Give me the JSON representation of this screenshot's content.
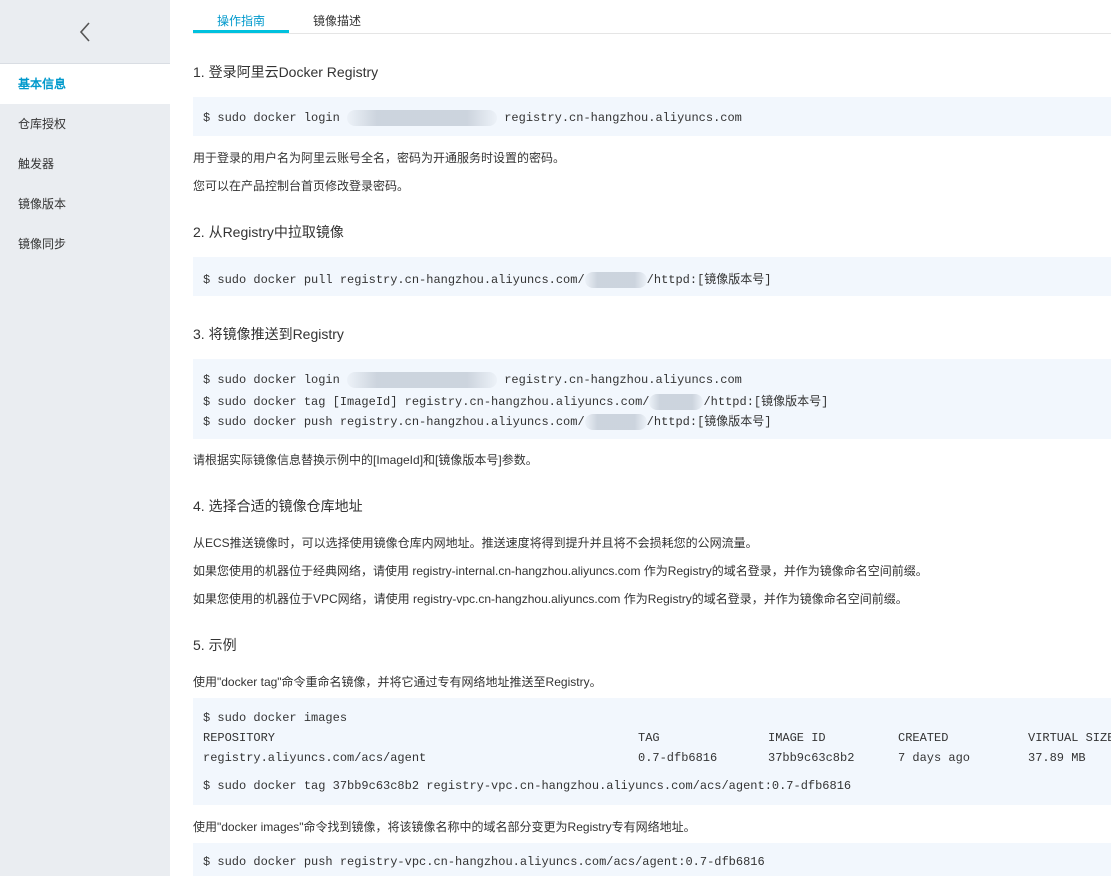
{
  "sidebar": {
    "items": [
      {
        "label": "基本信息",
        "active": true
      },
      {
        "label": "仓库授权"
      },
      {
        "label": "触发器"
      },
      {
        "label": "镜像版本"
      },
      {
        "label": "镜像同步"
      }
    ]
  },
  "tabs": [
    "操作指南",
    "镜像描述"
  ],
  "sections": {
    "s1": {
      "title": "1. 登录阿里云Docker Registry",
      "code": {
        "pre": "$ sudo docker login",
        "post": "registry.cn-hangzhou.aliyuncs.com"
      },
      "notes": [
        "用于登录的用户名为阿里云账号全名，密码为开通服务时设置的密码。",
        "您可以在产品控制台首页修改登录密码。"
      ]
    },
    "s2": {
      "title": "2. 从Registry中拉取镜像",
      "code": {
        "pre": "$ sudo docker pull registry.cn-hangzhou.aliyuncs.com/",
        "post": "/httpd:[镜像版本号]"
      }
    },
    "s3": {
      "title": "3. 将镜像推送到Registry",
      "lines": [
        {
          "pre": "$ sudo docker login",
          "post": "registry.cn-hangzhou.aliyuncs.com"
        },
        {
          "pre": "$ sudo docker tag [ImageId] registry.cn-hangzhou.aliyuncs.com/",
          "post": "/httpd:[镜像版本号]"
        },
        {
          "pre": "$ sudo docker push registry.cn-hangzhou.aliyuncs.com/",
          "post": "/httpd:[镜像版本号]"
        }
      ],
      "note": "请根据实际镜像信息替换示例中的[ImageId]和[镜像版本号]参数。"
    },
    "s4": {
      "title": "4. 选择合适的镜像仓库地址",
      "notes": [
        "从ECS推送镜像时，可以选择使用镜像仓库内网地址。推送速度将得到提升并且将不会损耗您的公网流量。",
        "如果您使用的机器位于经典网络，请使用 registry-internal.cn-hangzhou.aliyuncs.com 作为Registry的域名登录，并作为镜像命名空间前缀。",
        "如果您使用的机器位于VPC网络，请使用 registry-vpc.cn-hangzhou.aliyuncs.com 作为Registry的域名登录，并作为镜像命名空间前缀。"
      ]
    },
    "s5": {
      "title": "5. 示例",
      "note1": "使用\"docker tag\"命令重命名镜像，并将它通过专有网络地址推送至Registry。",
      "images_cmd": "$ sudo docker images",
      "table": {
        "headers": [
          "REPOSITORY",
          "TAG",
          "IMAGE ID",
          "CREATED",
          "VIRTUAL SIZE"
        ],
        "row": [
          "registry.aliyuncs.com/acs/agent",
          "0.7-dfb6816",
          "37bb9c63c8b2",
          "7 days ago",
          "37.89 MB"
        ]
      },
      "tag_cmd": "$ sudo docker tag 37bb9c63c8b2 registry-vpc.cn-hangzhou.aliyuncs.com/acs/agent:0.7-dfb6816",
      "note2": "使用\"docker images\"命令找到镜像，将该镜像名称中的域名部分变更为Registry专有网络地址。",
      "push_cmd": "$ sudo docker push registry-vpc.cn-hangzhou.aliyuncs.com/acs/agent:0.7-dfb6816"
    }
  },
  "colors": {
    "accent": "#00c1de",
    "sidebar_bg": "#eaedf1",
    "code_bg": "#f2f7fd"
  }
}
